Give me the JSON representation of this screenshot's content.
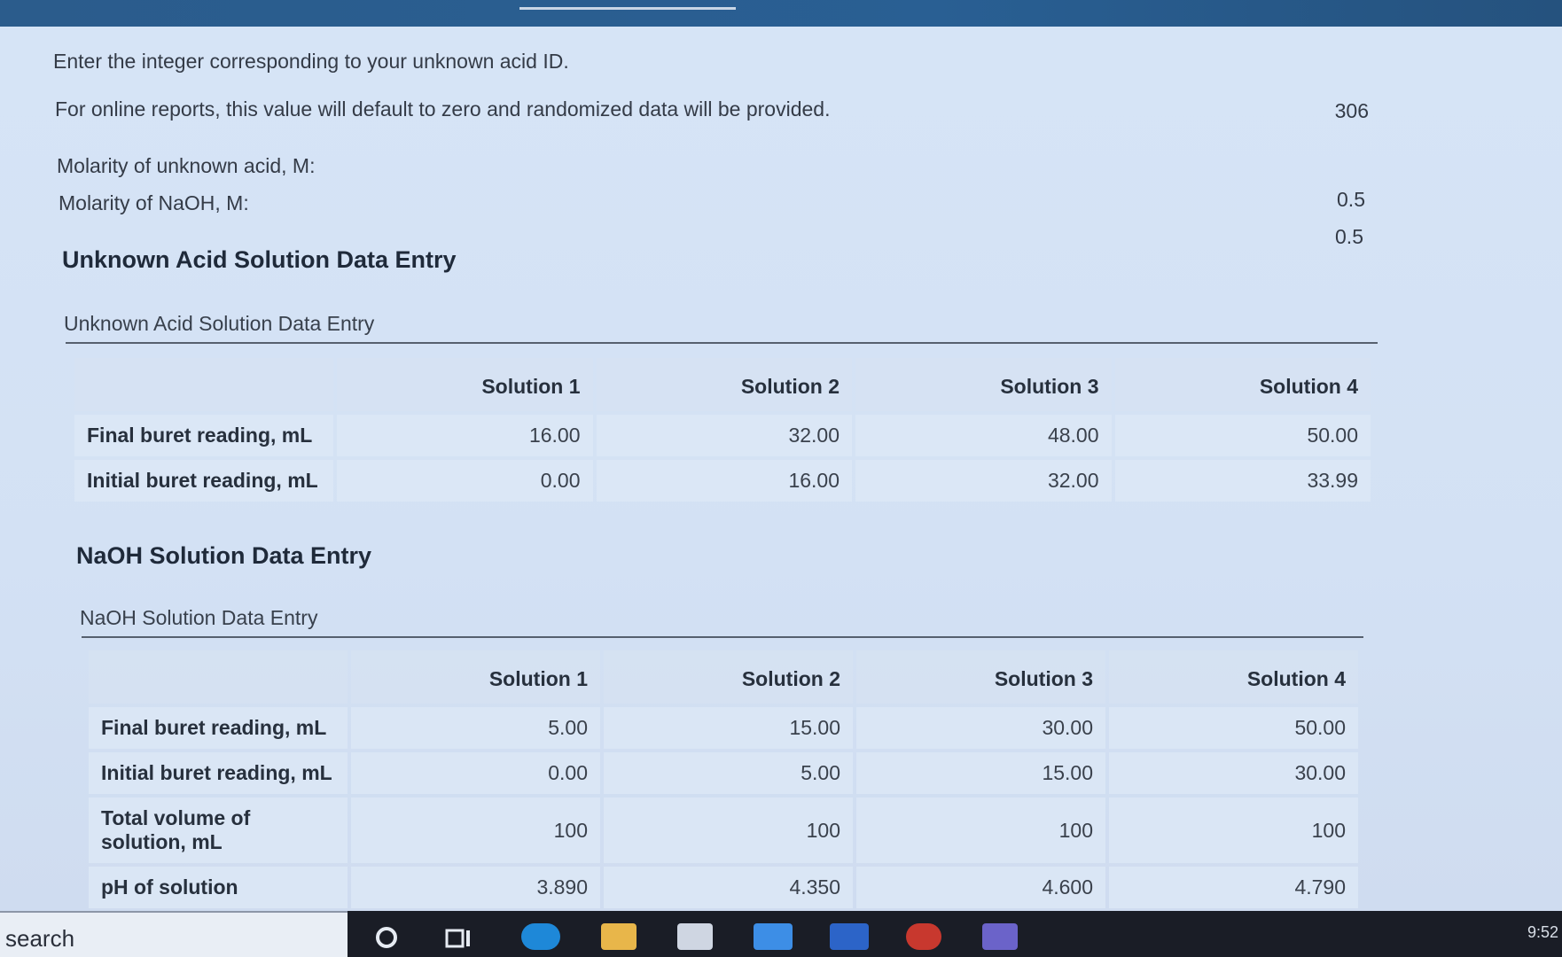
{
  "intro": {
    "line1": "Enter the integer corresponding to your unknown acid ID.",
    "line2": "For online reports, this value will default to zero and randomized data will be provided.",
    "acid_id": "306",
    "molarity_acid_label": "Molarity of unknown acid, M:",
    "molarity_naoh_label": "Molarity of NaOH, M:",
    "molarity_acid_value": "0.5",
    "molarity_naoh_value": "0.5"
  },
  "acid_section": {
    "title": "Unknown Acid Solution Data Entry",
    "caption": "Unknown Acid Solution Data Entry",
    "columns": [
      "Solution 1",
      "Solution 2",
      "Solution 3",
      "Solution 4"
    ],
    "rows": [
      {
        "label": "Final buret reading, mL",
        "values": [
          "16.00",
          "32.00",
          "48.00",
          "50.00"
        ]
      },
      {
        "label": "Initial buret reading, mL",
        "values": [
          "0.00",
          "16.00",
          "32.00",
          "33.99"
        ]
      }
    ]
  },
  "naoh_section": {
    "title": "NaOH Solution Data Entry",
    "caption": "NaOH Solution Data Entry",
    "columns": [
      "Solution 1",
      "Solution 2",
      "Solution 3",
      "Solution 4"
    ],
    "rows": [
      {
        "label": "Final buret reading, mL",
        "values": [
          "5.00",
          "15.00",
          "30.00",
          "50.00"
        ]
      },
      {
        "label": "Initial buret reading, mL",
        "values": [
          "0.00",
          "5.00",
          "15.00",
          "30.00"
        ]
      },
      {
        "label": "Total volume of solution, mL",
        "values": [
          "100",
          "100",
          "100",
          "100"
        ]
      },
      {
        "label": "pH of solution",
        "values": [
          "3.890",
          "4.350",
          "4.600",
          "4.790"
        ]
      }
    ]
  },
  "taskbar": {
    "search_label": "search",
    "clock": "9:52",
    "colors": {
      "edge": "#1e88d8",
      "explorer": "#e8b64a",
      "store": "#cfd6e2",
      "mail": "#3d8ee6",
      "word": "#2c64c8",
      "red_app": "#c8382e",
      "teams": "#6b63c9"
    }
  }
}
